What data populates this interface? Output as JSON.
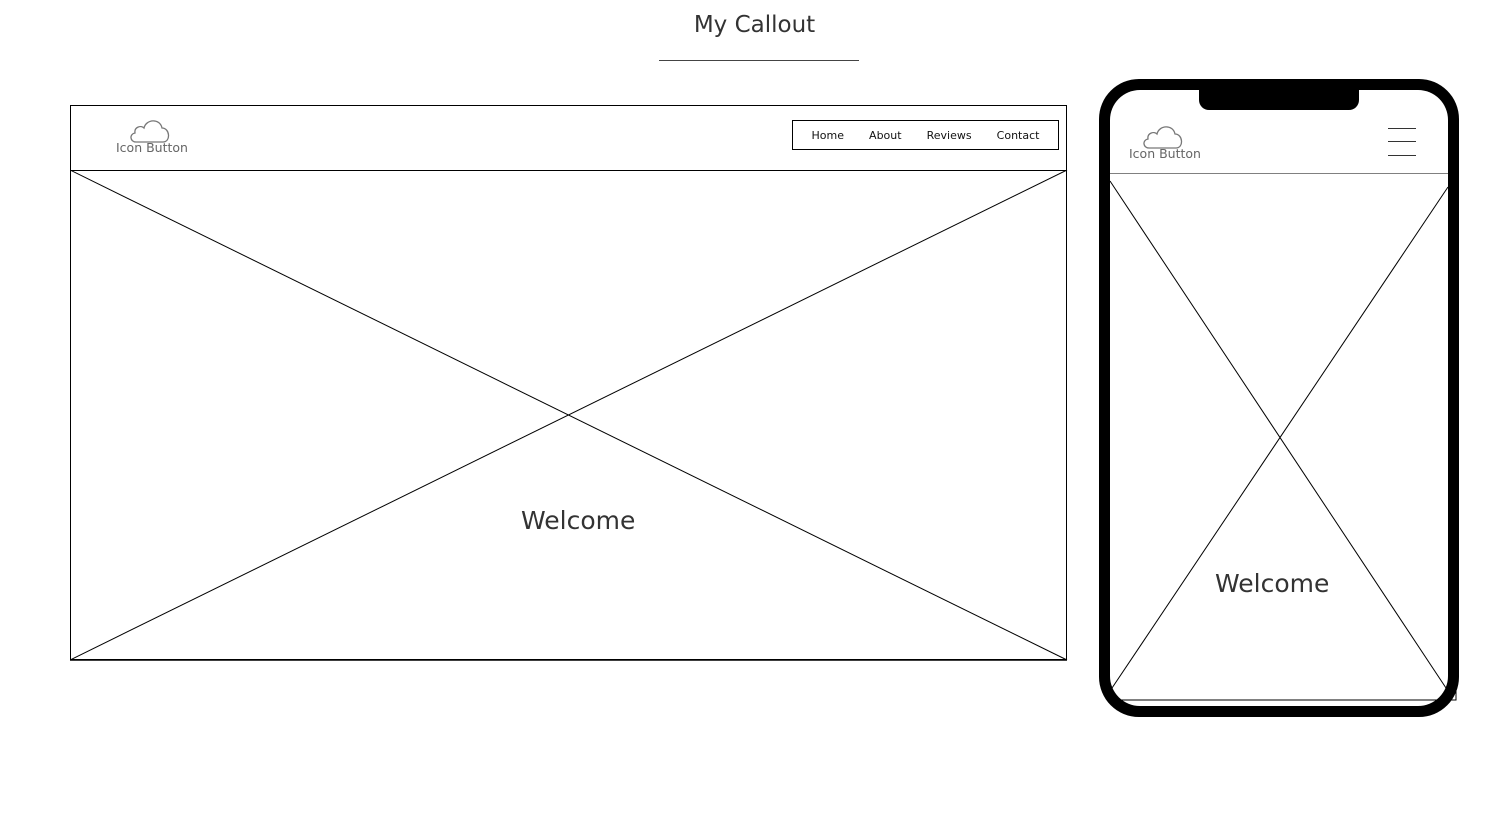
{
  "callout": {
    "title": "My Callout"
  },
  "desktop": {
    "logo_label": "Icon Button",
    "nav": [
      "Home",
      "About",
      "Reviews",
      "Contact"
    ],
    "hero_text": "Welcome"
  },
  "mobile": {
    "logo_label": "Icon Button",
    "hero_text": "Welcome"
  },
  "icons": {
    "logo": "cloud-icon",
    "menu": "hamburger-menu-icon"
  }
}
